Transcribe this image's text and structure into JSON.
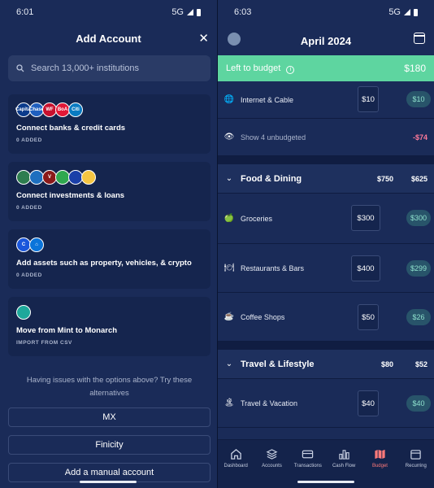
{
  "left": {
    "status": {
      "time": "6:01",
      "network": "5G"
    },
    "title": "Add Account",
    "search_placeholder": "Search 13,000+ institutions",
    "cards": [
      {
        "title": "Connect banks & credit cards",
        "sub": "0 ADDED"
      },
      {
        "title": "Connect investments & loans",
        "sub": "0 ADDED"
      },
      {
        "title": "Add assets such as property, vehicles, & crypto",
        "sub": "0 ADDED"
      },
      {
        "title": "Move from Mint to Monarch",
        "sub": "IMPORT FROM CSV"
      }
    ],
    "bank_logos": [
      "Capital",
      "Chase",
      "WF",
      "BoA",
      "Citi"
    ],
    "issue_text": "Having issues with the options above? Try these alternatives",
    "alternatives": [
      "MX",
      "Finicity",
      "Add a manual account"
    ]
  },
  "right": {
    "status": {
      "time": "6:03",
      "network": "5G"
    },
    "month": "April 2024",
    "left_to_budget": {
      "label": "Left to budget",
      "amount": "$180"
    },
    "internet": {
      "name": "Internet & Cable",
      "budget": "$10",
      "remaining": "$10"
    },
    "unbudgeted": {
      "label": "Show 4 unbudgeted",
      "amount": "-$74"
    },
    "food": {
      "name": "Food & Dining",
      "budget": "$750",
      "remaining": "$625",
      "items": [
        {
          "name": "Groceries",
          "budget": "$300",
          "remaining": "$300"
        },
        {
          "name": "Restaurants & Bars",
          "budget": "$400",
          "remaining": "$299"
        },
        {
          "name": "Coffee Shops",
          "budget": "$50",
          "remaining": "$26"
        }
      ]
    },
    "travel": {
      "name": "Travel & Lifestyle",
      "budget": "$80",
      "remaining": "$52",
      "items": [
        {
          "name": "Travel & Vacation",
          "budget": "$40",
          "remaining": "$40"
        }
      ]
    },
    "tabs": [
      "Dashboard",
      "Accounts",
      "Transactions",
      "Cash Flow",
      "Budget",
      "Recurring"
    ],
    "active_tab": "Budget",
    "colors": {
      "accent_green": "#5ed5a0",
      "active_tab": "#ff7a7a",
      "negative": "#ff7a9a"
    }
  }
}
